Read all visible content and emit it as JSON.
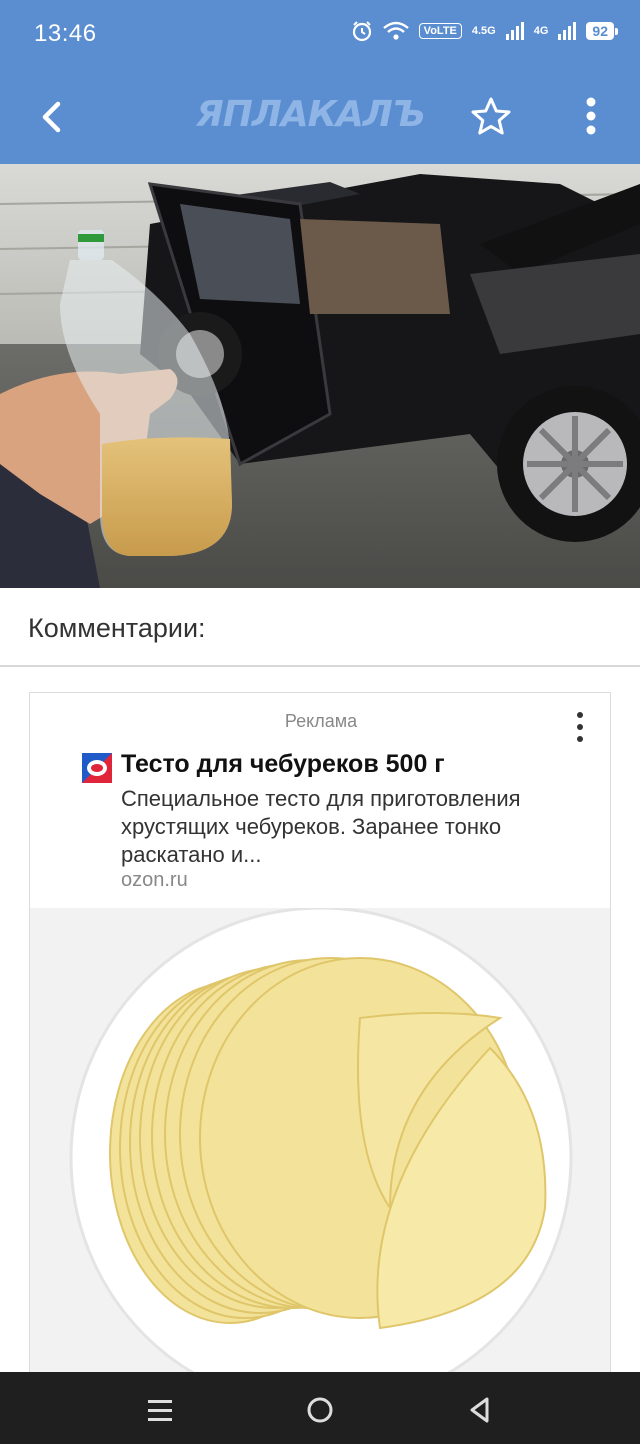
{
  "status_bar": {
    "time": "13:46",
    "volte": "VoLTE",
    "sim1_net": "4.5G",
    "sim2_net": "4G",
    "battery": "92",
    "icons": [
      "alarm-icon",
      "wifi-icon",
      "signal-icon",
      "signal-icon",
      "battery-icon"
    ]
  },
  "app_bar": {
    "logo": "ЯПЛАКАЛЪ",
    "icons": [
      "back-arrow-icon",
      "star-icon",
      "more-vertical-icon"
    ]
  },
  "comments": {
    "title": "Комментарии:"
  },
  "ad": {
    "label": "Реклама",
    "title": "Тесто для чебуреков 500 г",
    "description": "Специальное тесто для приготовления хрустящих чебуреков. Заранее тонко раскатано и...",
    "domain": "ozon.ru",
    "icons": [
      "more-vertical-icon",
      "ozon-logo-icon"
    ]
  },
  "nav_bar": {
    "icons": [
      "menu-lines-icon",
      "home-circle-icon",
      "back-triangle-icon"
    ]
  },
  "colors": {
    "app_bar": "#5b8ed0",
    "logo": "#8fb4e6",
    "nav_bar": "#1f1f1f"
  }
}
